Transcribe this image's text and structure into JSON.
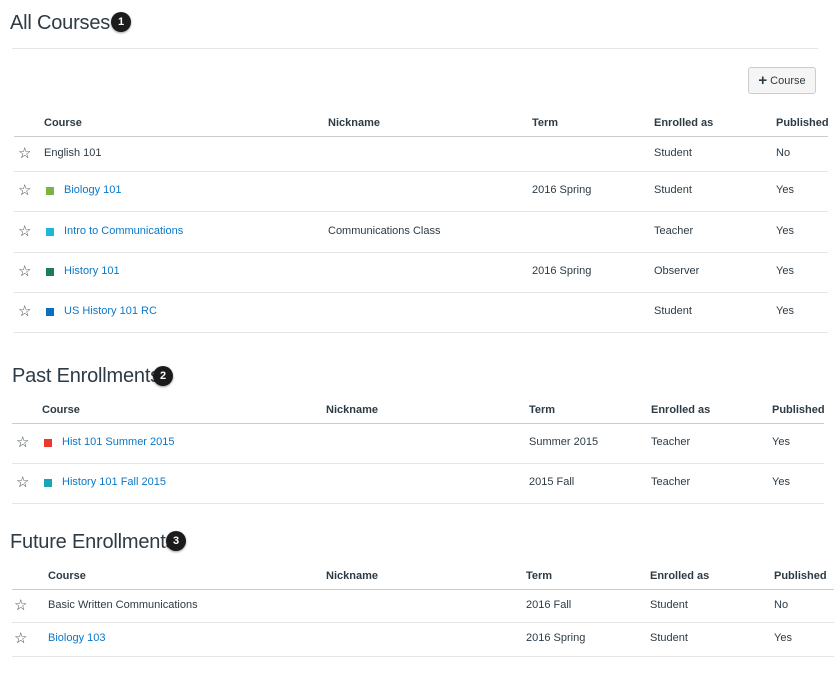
{
  "add_course_label": "Course",
  "sections": [
    {
      "title": "All Courses",
      "badge": "1",
      "columns": {
        "course": "Course",
        "nickname": "Nickname",
        "term": "Term",
        "enrolled_as": "Enrolled as",
        "published": "Published"
      },
      "rows": [
        {
          "course": "English 101",
          "nickname": "",
          "term": "",
          "enrolled_as": "Student",
          "published": "No",
          "color": "",
          "link": false
        },
        {
          "course": "Biology 101",
          "nickname": "",
          "term": "2016 Spring",
          "enrolled_as": "Student",
          "published": "Yes",
          "color": "#7cb342",
          "link": true
        },
        {
          "course": "Intro to Communications",
          "nickname": "Communications Class",
          "term": "",
          "enrolled_as": "Teacher",
          "published": "Yes",
          "color": "#1fb5d6",
          "link": true
        },
        {
          "course": "History 101",
          "nickname": "",
          "term": "2016 Spring",
          "enrolled_as": "Observer",
          "published": "Yes",
          "color": "#1e7a5a",
          "link": true
        },
        {
          "course": "US History 101 RC",
          "nickname": "",
          "term": "",
          "enrolled_as": "Student",
          "published": "Yes",
          "color": "#0b6fc0",
          "link": true
        }
      ]
    },
    {
      "title": "Past Enrollments",
      "badge": "2",
      "columns": {
        "course": "Course",
        "nickname": "Nickname",
        "term": "Term",
        "enrolled_as": "Enrolled as",
        "published": "Published"
      },
      "rows": [
        {
          "course": "Hist 101 Summer 2015",
          "nickname": "",
          "term": "Summer 2015",
          "enrolled_as": "Teacher",
          "published": "Yes",
          "color": "#ea3a2e",
          "link": true
        },
        {
          "course": "History 101 Fall 2015",
          "nickname": "",
          "term": "2015 Fall",
          "enrolled_as": "Teacher",
          "published": "Yes",
          "color": "#16a6b8",
          "link": true
        }
      ]
    },
    {
      "title": "Future Enrollments",
      "badge": "3",
      "columns": {
        "course": "Course",
        "nickname": "Nickname",
        "term": "Term",
        "enrolled_as": "Enrolled as",
        "published": "Published"
      },
      "rows": [
        {
          "course": "Basic Written Communications",
          "nickname": "",
          "term": "2016 Fall",
          "enrolled_as": "Student",
          "published": "No",
          "color": "",
          "link": false
        },
        {
          "course": "Biology 103",
          "nickname": "",
          "term": "2016 Spring",
          "enrolled_as": "Student",
          "published": "Yes",
          "color": "",
          "link": true
        }
      ]
    }
  ]
}
